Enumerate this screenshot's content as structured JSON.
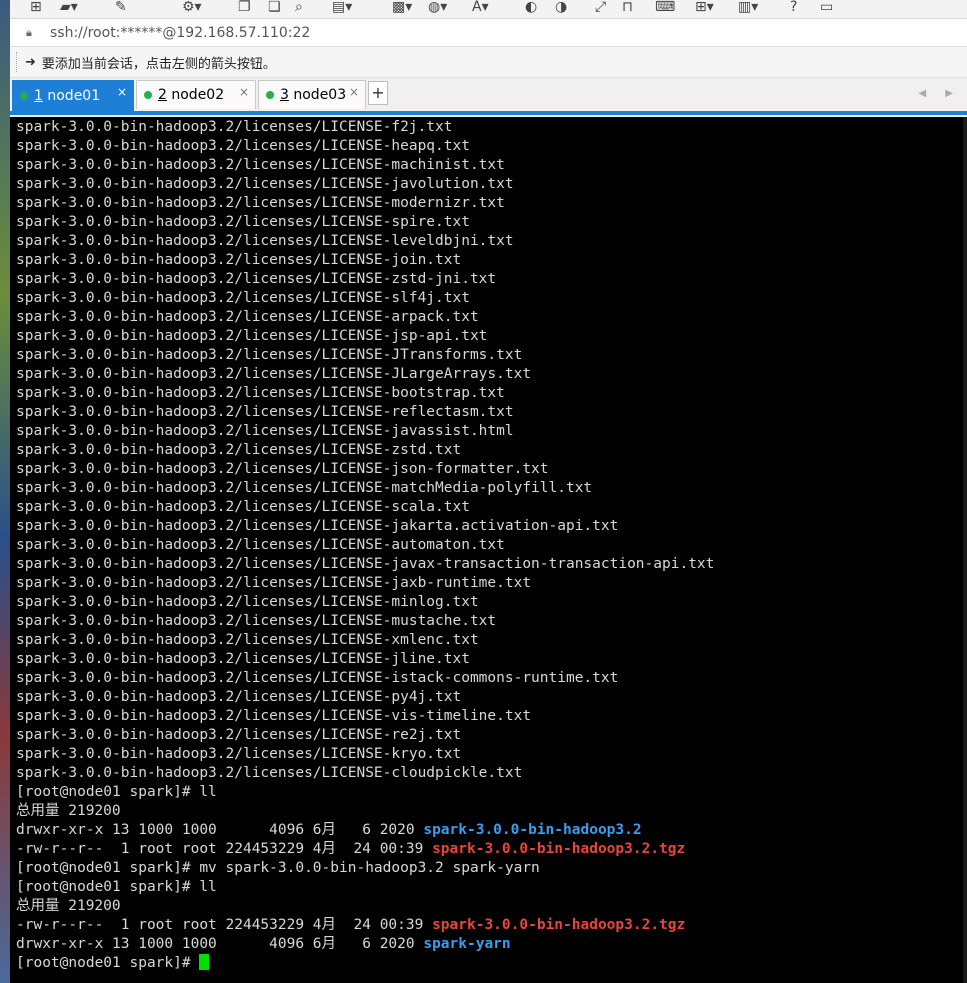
{
  "address": {
    "url": "ssh://root:******@192.168.57.110:22"
  },
  "hint": {
    "text": "要添加当前会话，点击左侧的箭头按钮。"
  },
  "tabs": [
    {
      "num": "1",
      "name": " node01",
      "close": "×",
      "active": true
    },
    {
      "num": "2",
      "name": " node02",
      "close": "×",
      "active": false
    },
    {
      "num": "3",
      "name": " node03",
      "close": "×",
      "active": false
    }
  ],
  "new_tab": "+",
  "tab_nav": "◀ ▶",
  "colors": {
    "accent": "#1e7fd6",
    "dir": "#3a9ef0",
    "archive": "#e8453c",
    "cursor": "#00e000",
    "status_dot": "#22b14c"
  },
  "terminal": {
    "license_prefix": "spark-3.0.0-bin-hadoop3.2/licenses/",
    "license_files": [
      "LICENSE-f2j.txt",
      "LICENSE-heapq.txt",
      "LICENSE-machinist.txt",
      "LICENSE-javolution.txt",
      "LICENSE-modernizr.txt",
      "LICENSE-spire.txt",
      "LICENSE-leveldbjni.txt",
      "LICENSE-join.txt",
      "LICENSE-zstd-jni.txt",
      "LICENSE-slf4j.txt",
      "LICENSE-arpack.txt",
      "LICENSE-jsp-api.txt",
      "LICENSE-JTransforms.txt",
      "LICENSE-JLargeArrays.txt",
      "LICENSE-bootstrap.txt",
      "LICENSE-reflectasm.txt",
      "LICENSE-javassist.html",
      "LICENSE-zstd.txt",
      "LICENSE-json-formatter.txt",
      "LICENSE-matchMedia-polyfill.txt",
      "LICENSE-scala.txt",
      "LICENSE-jakarta.activation-api.txt",
      "LICENSE-automaton.txt",
      "LICENSE-javax-transaction-transaction-api.txt",
      "LICENSE-jaxb-runtime.txt",
      "LICENSE-minlog.txt",
      "LICENSE-mustache.txt",
      "LICENSE-xmlenc.txt",
      "LICENSE-jline.txt",
      "LICENSE-istack-commons-runtime.txt",
      "LICENSE-py4j.txt",
      "LICENSE-vis-timeline.txt",
      "LICENSE-re2j.txt",
      "LICENSE-kryo.txt",
      "LICENSE-cloudpickle.txt"
    ],
    "tail": [
      {
        "text": "[root@node01 spark]# ll"
      },
      {
        "text": "总用量 219200"
      },
      {
        "text": "drwxr-xr-x 13 1000 1000      4096 6月   6 2020 ",
        "hl": "spark-3.0.0-bin-hadoop3.2",
        "cls": "dir"
      },
      {
        "text": "-rw-r--r--  1 root root 224453229 4月  24 00:39 ",
        "hl": "spark-3.0.0-bin-hadoop3.2.tgz",
        "cls": "tgz"
      },
      {
        "text": "[root@node01 spark]# mv spark-3.0.0-bin-hadoop3.2 spark-yarn"
      },
      {
        "text": "[root@node01 spark]# ll"
      },
      {
        "text": "总用量 219200"
      },
      {
        "text": "-rw-r--r--  1 root root 224453229 4月  24 00:39 ",
        "hl": "spark-3.0.0-bin-hadoop3.2.tgz",
        "cls": "tgz"
      },
      {
        "text": "drwxr-xr-x 13 1000 1000      4096 6月   6 2020 ",
        "hl": "spark-yarn",
        "cls": "dir"
      }
    ],
    "prompt": "[root@node01 spark]# "
  }
}
